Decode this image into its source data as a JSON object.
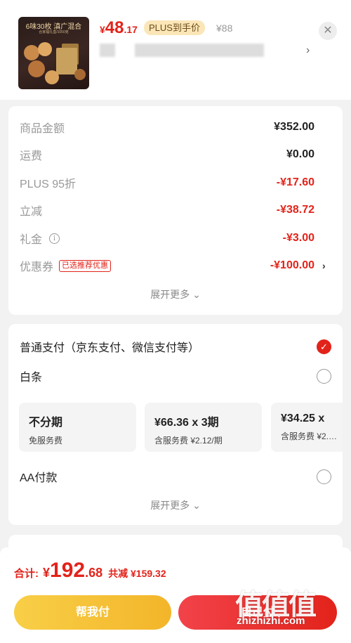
{
  "product": {
    "image_text_line1": "6味30枚 滇广混合",
    "image_text_line2": "合家福礼盒/1050克",
    "currency": "¥",
    "price_int": "48",
    "price_dec": ".17",
    "plus_tag": "PLUS到手价",
    "original_price": "¥88",
    "close_icon": "close-icon",
    "spec_arrow": "›"
  },
  "breakdown": {
    "rows": [
      {
        "label": "商品金额",
        "value": "¥352.00",
        "color": "#222222"
      },
      {
        "label": "运费",
        "value": "¥0.00",
        "color": "#222222"
      },
      {
        "label": "PLUS 95折",
        "value": "-¥17.60",
        "color": "#e2231a"
      },
      {
        "label": "立减",
        "value": "-¥38.72",
        "color": "#e2231a"
      },
      {
        "label": "礼金",
        "value": "-¥3.00",
        "color": "#e2231a",
        "info_icon": "i"
      },
      {
        "label": "优惠券",
        "value": "-¥100.00",
        "color": "#e2231a",
        "tag": "已选推荐优惠"
      }
    ],
    "row_arrow": "›",
    "expand_more": "展开更多 ⌄"
  },
  "payment": {
    "options": [
      {
        "label": "普通支付（京东支付、微信支付等）",
        "selected": true,
        "check": "✓"
      },
      {
        "label": "白条",
        "selected": false
      },
      {
        "label": "AA付款",
        "selected": false
      }
    ],
    "installments": [
      {
        "title": "不分期",
        "sub": "免服务费"
      },
      {
        "title": "¥66.36 x 3期",
        "sub": "含服务费 ¥2.12/期"
      },
      {
        "title": "¥34.25 x",
        "sub": "含服务费 ¥2.…"
      }
    ],
    "expand_more": "展开更多 ⌄"
  },
  "bottom": {
    "total_label": "合计:",
    "currency": "¥",
    "total_int": "192",
    "total_dec": ".68",
    "saved": "共减 ¥159.32",
    "help_pay": "帮我付",
    "self_pay": "自己付"
  },
  "watermark": {
    "glyphs": "值值值",
    "url": "zhizhizhi.com"
  },
  "colors": {
    "accent_red": "#e2231a",
    "plus_gold": "#fbe6b7",
    "help_button": "#f3b52a"
  }
}
